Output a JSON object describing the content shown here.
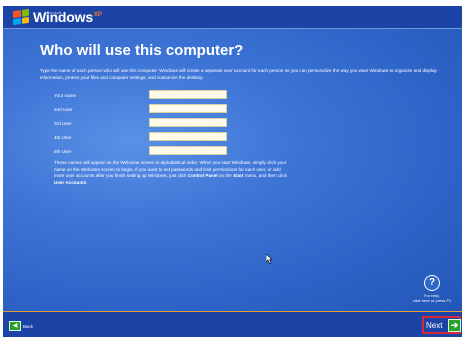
{
  "header": {
    "brand": "Windows",
    "brand_super": "XP",
    "microsoft": "Microsoft",
    "colors": {
      "bar": "#1c43a6",
      "flag_red": "#f35325",
      "flag_green": "#81bc06",
      "flag_blue": "#05a6f0",
      "flag_yellow": "#ffba08"
    }
  },
  "main": {
    "title": "Who will use this computer?",
    "intro": "Type the name of each person who will use this computer. Windows will create a separate user account for each person so you can personalize the way you want Windows to organize and display information, protect your files and computer settings, and customize the desktop.",
    "fields": [
      {
        "label": "Your name",
        "value": ""
      },
      {
        "label": "2nd User",
        "value": ""
      },
      {
        "label": "3rd User",
        "value": ""
      },
      {
        "label": "4th User",
        "value": ""
      },
      {
        "label": "5th User",
        "value": ""
      }
    ],
    "note_part1": "These names will appear on the Welcome screen in alphabetical order. When you start Windows, simply click your name on the Welcome screen to begin. If you want to set passwords and limit permissions for each user, or add more user accounts after you finish setting up Windows, just click ",
    "note_bold1": "Control Panel",
    "note_part2": " on the ",
    "note_bold2": "Start",
    "note_part3": " menu, and then click ",
    "note_bold3": "User Accounts",
    "note_part4": "."
  },
  "help": {
    "icon": "question-icon",
    "symbol": "?",
    "line1": "For help,",
    "line2": "click here or press F1"
  },
  "footer": {
    "back_label": "Back",
    "next_label": "Next",
    "back_icon": "arrow-left-icon",
    "next_icon": "arrow-right-icon",
    "highlight_color": "#d8293a"
  }
}
